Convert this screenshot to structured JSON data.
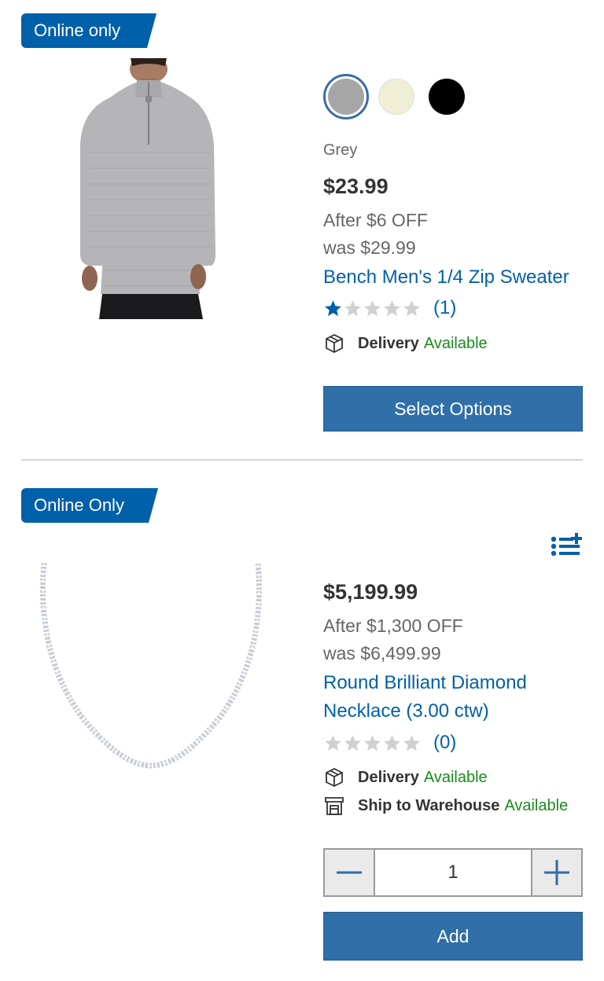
{
  "products": [
    {
      "badge": "Online only",
      "image_alt": "Man wearing grey quarter-zip sweater",
      "swatches": [
        {
          "name": "grey",
          "color": "#a6a6a6",
          "selected": true
        },
        {
          "name": "cream",
          "color": "#f0efd6",
          "selected": false
        },
        {
          "name": "black",
          "color": "#000000",
          "selected": false
        }
      ],
      "color_name": "Grey",
      "price": "$23.99",
      "discount": "After $6 OFF",
      "was_price": "was $29.99",
      "title": "Bench Men's 1/4 Zip Sweater",
      "rating": 1,
      "review_count": "(1)",
      "delivery_label": "Delivery",
      "delivery_status": "Available",
      "button_label": "Select Options"
    },
    {
      "badge": "Online Only",
      "image_alt": "Diamond tennis necklace",
      "price": "$5,199.99",
      "discount": "After $1,300 OFF",
      "was_price": "was $6,499.99",
      "title": "Round Brilliant Diamond Necklace (3.00 ctw)",
      "rating": 0,
      "review_count": "(0)",
      "delivery_label": "Delivery",
      "delivery_status": "Available",
      "warehouse_label": "Ship to Warehouse",
      "warehouse_status": "Available",
      "quantity": "1",
      "button_label": "Add"
    }
  ],
  "colors": {
    "brand_blue": "#0060a9",
    "button_blue": "#306fa8",
    "available_green": "#198b1d"
  }
}
